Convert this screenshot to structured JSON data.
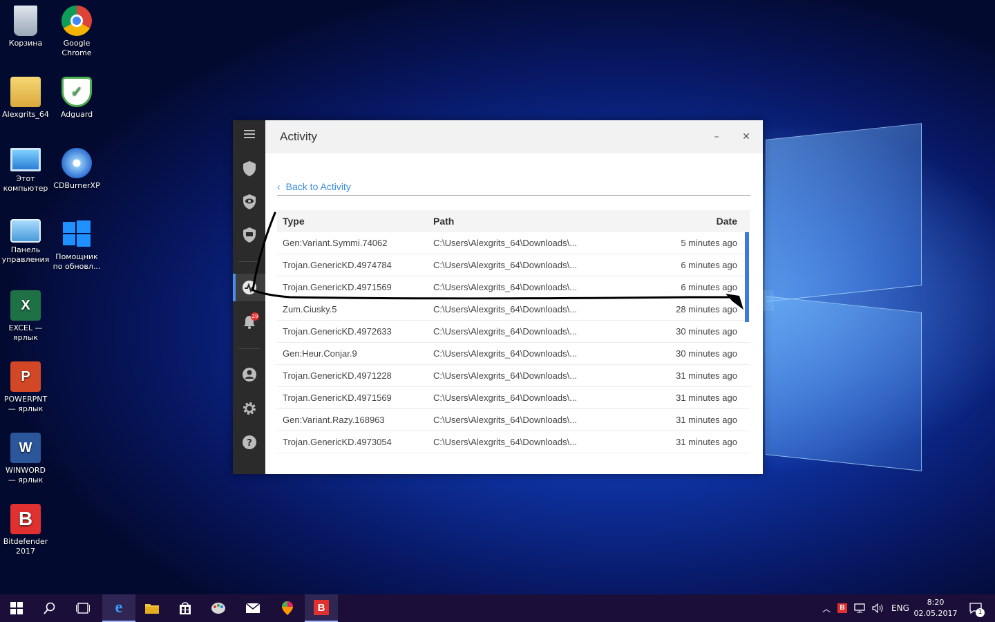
{
  "desktop": {
    "icons": [
      {
        "label": "Корзина",
        "icon": "recycle-bin-icon"
      },
      {
        "label": "Google\nChrome",
        "icon": "chrome-icon"
      },
      {
        "label": "Alexgrits_64",
        "icon": "user-folder-icon"
      },
      {
        "label": "Adguard",
        "icon": "adguard-shield-icon"
      },
      {
        "label": "Этот\nкомпьютер",
        "icon": "computer-icon"
      },
      {
        "label": "CDBurnerXP",
        "icon": "cd-burner-icon"
      },
      {
        "label": "Панель\nуправления",
        "icon": "control-panel-icon"
      },
      {
        "label": "Помощник\nпо обновл...",
        "icon": "windows-update-icon"
      },
      {
        "label": "EXCEL —\nярлык",
        "icon": "excel-icon"
      },
      {
        "label": "POWERPNT\n— ярлык",
        "icon": "powerpoint-icon"
      },
      {
        "label": "WINWORD\n— ярлык",
        "icon": "word-icon"
      },
      {
        "label": "Bitdefender\n2017",
        "icon": "bitdefender-icon"
      }
    ]
  },
  "app": {
    "title": "Activity",
    "back_label": "Back to Activity",
    "notification_count": "29",
    "table": {
      "headers": {
        "type": "Type",
        "path": "Path",
        "date": "Date"
      },
      "rows": [
        {
          "type": "Gen:Variant.Symmi.74062",
          "path": "C:\\Users\\Alexgrits_64\\Downloads\\...",
          "date": "5 minutes ago"
        },
        {
          "type": "Trojan.GenericKD.4974784",
          "path": "C:\\Users\\Alexgrits_64\\Downloads\\...",
          "date": "6 minutes ago"
        },
        {
          "type": "Trojan.GenericKD.4971569",
          "path": "C:\\Users\\Alexgrits_64\\Downloads\\...",
          "date": "6 minutes ago"
        },
        {
          "type": "Zum.Ciusky.5",
          "path": "C:\\Users\\Alexgrits_64\\Downloads\\...",
          "date": "28 minutes ago"
        },
        {
          "type": "Trojan.GenericKD.4972633",
          "path": "C:\\Users\\Alexgrits_64\\Downloads\\...",
          "date": "30 minutes ago"
        },
        {
          "type": "Gen:Heur.Conjar.9",
          "path": "C:\\Users\\Alexgrits_64\\Downloads\\...",
          "date": "30 minutes ago"
        },
        {
          "type": "Trojan.GenericKD.4971228",
          "path": "C:\\Users\\Alexgrits_64\\Downloads\\...",
          "date": "31 minutes ago"
        },
        {
          "type": "Trojan.GenericKD.4971569",
          "path": "C:\\Users\\Alexgrits_64\\Downloads\\...",
          "date": "31 minutes ago"
        },
        {
          "type": "Gen:Variant.Razy.168963",
          "path": "C:\\Users\\Alexgrits_64\\Downloads\\...",
          "date": "31 minutes ago"
        },
        {
          "type": "Trojan.GenericKD.4973054",
          "path": "C:\\Users\\Alexgrits_64\\Downloads\\...",
          "date": "31 minutes ago"
        }
      ]
    }
  },
  "taskbar": {
    "tray_language": "ENG",
    "time": "8:20",
    "date": "02.05.2017",
    "notification_count": "1"
  },
  "colors": {
    "accent": "#4a90e2",
    "link": "#3c8ce0",
    "rail": "#2b2b2b",
    "bitdefender": "#e0302f"
  }
}
